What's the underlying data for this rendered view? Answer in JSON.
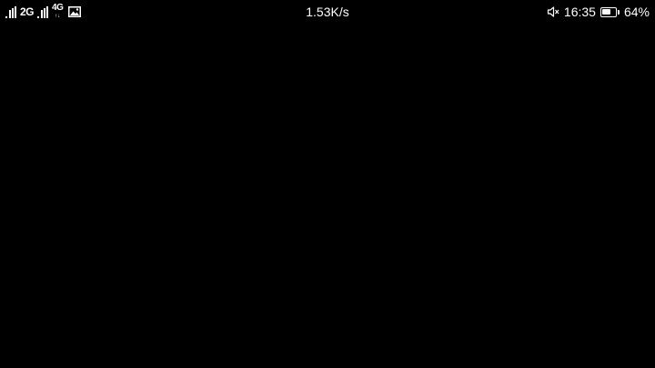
{
  "status_bar": {
    "sim1": {
      "icon": "signal-icon",
      "bars": 3
    },
    "sim1_network": "2G",
    "sim2": {
      "icon": "signal-icon",
      "bars": 3
    },
    "sim2_network": "4G",
    "sim2_arrows": "↑↓",
    "notification_icon": "image-icon",
    "net_speed": "1.53K/s",
    "volume_icon": "mute-icon",
    "time": "16:35",
    "battery": {
      "icon": "battery-icon",
      "level": 0.64
    },
    "battery_percent": "64%"
  },
  "content": {
    "background_color": "#000000"
  }
}
